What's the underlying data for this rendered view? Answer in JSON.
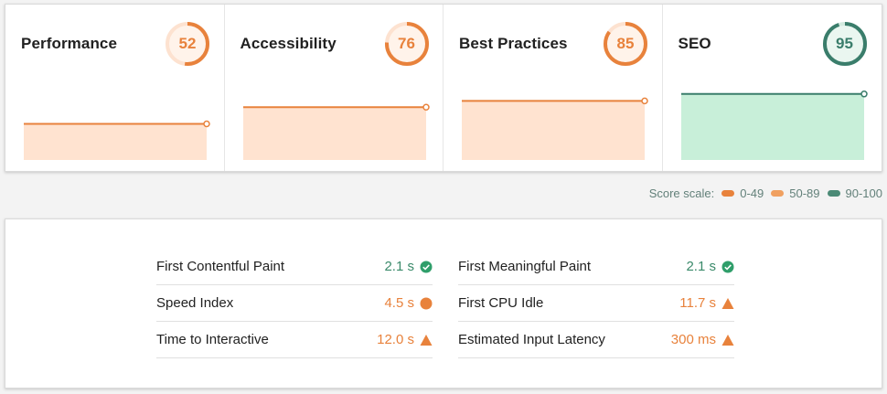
{
  "colors": {
    "pass": "#2e8b57",
    "average": "#f0a060",
    "fail": "#e8823c",
    "orange_fill": "#ffe3d0",
    "green_fill": "#c8efd9",
    "green_line": "#3a7d6b",
    "text_pass": "#3a8a6a",
    "text_avg": "#e8823c"
  },
  "categories": [
    {
      "name": "Performance",
      "score": 52,
      "tier": "average"
    },
    {
      "name": "Accessibility",
      "score": 76,
      "tier": "average"
    },
    {
      "name": "Best Practices",
      "score": 85,
      "tier": "average"
    },
    {
      "name": "SEO",
      "score": 95,
      "tier": "pass"
    }
  ],
  "score_scale": {
    "label": "Score scale:",
    "ranges": [
      {
        "label": "0-49",
        "tier": "fail"
      },
      {
        "label": "50-89",
        "tier": "average"
      },
      {
        "label": "90-100",
        "tier": "pass"
      }
    ]
  },
  "metrics": [
    {
      "label": "First Contentful Paint",
      "value": "2.1 s",
      "status": "pass",
      "icon": "check-circle-icon"
    },
    {
      "label": "First Meaningful Paint",
      "value": "2.1 s",
      "status": "pass",
      "icon": "check-circle-icon"
    },
    {
      "label": "Speed Index",
      "value": "4.5 s",
      "status": "average",
      "icon": "circle-icon"
    },
    {
      "label": "First CPU Idle",
      "value": "11.7 s",
      "status": "average",
      "icon": "triangle-warning-icon"
    },
    {
      "label": "Time to Interactive",
      "value": "12.0 s",
      "status": "average",
      "icon": "triangle-warning-icon"
    },
    {
      "label": "Estimated Input Latency",
      "value": "300 ms",
      "status": "average",
      "icon": "triangle-warning-icon"
    }
  ]
}
